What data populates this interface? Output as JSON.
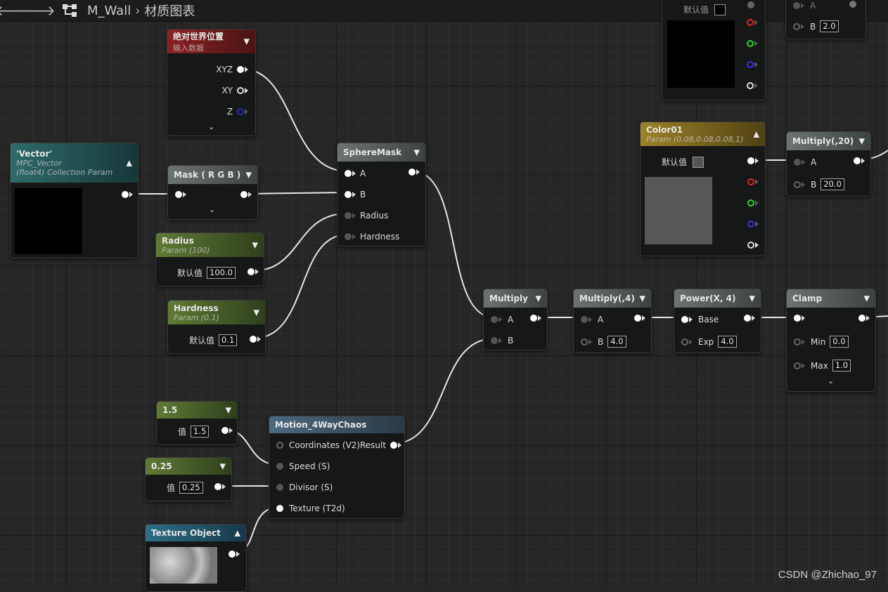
{
  "toolbar": {
    "back_icon": "back-arrow-icon",
    "forward_icon": "forward-arrow-icon",
    "graph_icon": "graph-icon",
    "asset_name": "M_Wall",
    "separator": "›",
    "graph_name": "材质图表"
  },
  "colors": {
    "background": "#262626",
    "wire": "#e6e6e6",
    "param_header": "#607a35",
    "function_header": "#4d6a80"
  },
  "nodes": {
    "absworldpos": {
      "title": "绝对世界位置",
      "subtitle": "输入数据",
      "pins": [
        "XYZ",
        "XY",
        "Z"
      ]
    },
    "vector": {
      "title": "'Vector'",
      "sub1": "MPC_Vector",
      "sub2": "(float4) Collection Param"
    },
    "mask": {
      "title": "Mask ( R G B )"
    },
    "radius": {
      "title": "Radius",
      "subtitle": "Param (100)",
      "label": "默认值",
      "value": "100.0"
    },
    "hardness": {
      "title": "Hardness",
      "subtitle": "Param (0.1)",
      "label": "默认值",
      "value": "0.1"
    },
    "spheremask": {
      "title": "SphereMask",
      "pins": [
        "A",
        "B",
        "Radius",
        "Hardness"
      ]
    },
    "multiply1": {
      "title": "Multiply",
      "pins": [
        "A",
        "B"
      ]
    },
    "multiply4": {
      "title": "Multiply(,4)",
      "pin_a": "A",
      "pin_b": "B",
      "value_b": "4.0"
    },
    "power": {
      "title": "Power(X, 4)",
      "pin_base": "Base",
      "pin_exp": "Exp",
      "value_exp": "4.0"
    },
    "clamp": {
      "title": "Clamp",
      "pin_min": "Min",
      "value_min": "0.0",
      "pin_max": "Max",
      "value_max": "1.0"
    },
    "color01": {
      "title": "Color01",
      "subtitle": "Param (0.08,0.08,0.08,1)",
      "label": "默认值"
    },
    "multiply20": {
      "title": "Multiply(,20)",
      "pin_a": "A",
      "pin_b": "B",
      "value_b": "20.0"
    },
    "topcolor": {
      "label": "默认值"
    },
    "topmultiply": {
      "pin_a": "A",
      "pin_b": "B",
      "value_b": "2.0"
    },
    "const15": {
      "title": "1.5",
      "label": "值",
      "value": "1.5"
    },
    "const025": {
      "title": "0.25",
      "label": "值",
      "value": "0.25"
    },
    "motion": {
      "title": "Motion_4WayChaos",
      "pins": [
        "Coordinates (V2)",
        "Speed (S)",
        "Divisor (S)",
        "Texture (T2d)"
      ],
      "output": "Result"
    },
    "texobj": {
      "title": "Texture Object"
    }
  },
  "watermark": "CSDN @Zhichao_97"
}
